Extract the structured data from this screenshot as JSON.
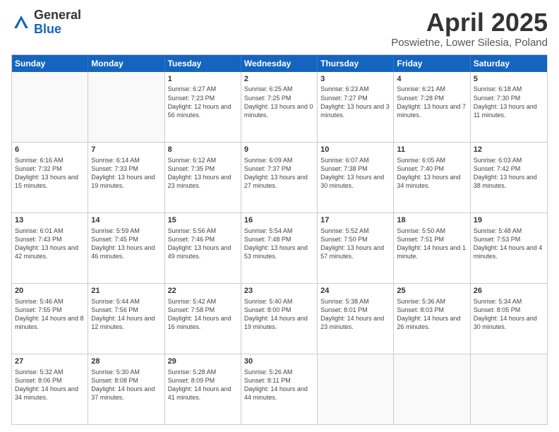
{
  "logo": {
    "general": "General",
    "blue": "Blue"
  },
  "title": {
    "month": "April 2025",
    "location": "Poswietne, Lower Silesia, Poland"
  },
  "weekdays": [
    "Sunday",
    "Monday",
    "Tuesday",
    "Wednesday",
    "Thursday",
    "Friday",
    "Saturday"
  ],
  "weeks": [
    [
      {
        "day": "",
        "info": ""
      },
      {
        "day": "",
        "info": ""
      },
      {
        "day": "1",
        "info": "Sunrise: 6:27 AM\nSunset: 7:23 PM\nDaylight: 12 hours and 56 minutes."
      },
      {
        "day": "2",
        "info": "Sunrise: 6:25 AM\nSunset: 7:25 PM\nDaylight: 13 hours and 0 minutes."
      },
      {
        "day": "3",
        "info": "Sunrise: 6:23 AM\nSunset: 7:27 PM\nDaylight: 13 hours and 3 minutes."
      },
      {
        "day": "4",
        "info": "Sunrise: 6:21 AM\nSunset: 7:28 PM\nDaylight: 13 hours and 7 minutes."
      },
      {
        "day": "5",
        "info": "Sunrise: 6:18 AM\nSunset: 7:30 PM\nDaylight: 13 hours and 11 minutes."
      }
    ],
    [
      {
        "day": "6",
        "info": "Sunrise: 6:16 AM\nSunset: 7:32 PM\nDaylight: 13 hours and 15 minutes."
      },
      {
        "day": "7",
        "info": "Sunrise: 6:14 AM\nSunset: 7:33 PM\nDaylight: 13 hours and 19 minutes."
      },
      {
        "day": "8",
        "info": "Sunrise: 6:12 AM\nSunset: 7:35 PM\nDaylight: 13 hours and 23 minutes."
      },
      {
        "day": "9",
        "info": "Sunrise: 6:09 AM\nSunset: 7:37 PM\nDaylight: 13 hours and 27 minutes."
      },
      {
        "day": "10",
        "info": "Sunrise: 6:07 AM\nSunset: 7:38 PM\nDaylight: 13 hours and 30 minutes."
      },
      {
        "day": "11",
        "info": "Sunrise: 6:05 AM\nSunset: 7:40 PM\nDaylight: 13 hours and 34 minutes."
      },
      {
        "day": "12",
        "info": "Sunrise: 6:03 AM\nSunset: 7:42 PM\nDaylight: 13 hours and 38 minutes."
      }
    ],
    [
      {
        "day": "13",
        "info": "Sunrise: 6:01 AM\nSunset: 7:43 PM\nDaylight: 13 hours and 42 minutes."
      },
      {
        "day": "14",
        "info": "Sunrise: 5:59 AM\nSunset: 7:45 PM\nDaylight: 13 hours and 46 minutes."
      },
      {
        "day": "15",
        "info": "Sunrise: 5:56 AM\nSunset: 7:46 PM\nDaylight: 13 hours and 49 minutes."
      },
      {
        "day": "16",
        "info": "Sunrise: 5:54 AM\nSunset: 7:48 PM\nDaylight: 13 hours and 53 minutes."
      },
      {
        "day": "17",
        "info": "Sunrise: 5:52 AM\nSunset: 7:50 PM\nDaylight: 13 hours and 57 minutes."
      },
      {
        "day": "18",
        "info": "Sunrise: 5:50 AM\nSunset: 7:51 PM\nDaylight: 14 hours and 1 minute."
      },
      {
        "day": "19",
        "info": "Sunrise: 5:48 AM\nSunset: 7:53 PM\nDaylight: 14 hours and 4 minutes."
      }
    ],
    [
      {
        "day": "20",
        "info": "Sunrise: 5:46 AM\nSunset: 7:55 PM\nDaylight: 14 hours and 8 minutes."
      },
      {
        "day": "21",
        "info": "Sunrise: 5:44 AM\nSunset: 7:56 PM\nDaylight: 14 hours and 12 minutes."
      },
      {
        "day": "22",
        "info": "Sunrise: 5:42 AM\nSunset: 7:58 PM\nDaylight: 14 hours and 16 minutes."
      },
      {
        "day": "23",
        "info": "Sunrise: 5:40 AM\nSunset: 8:00 PM\nDaylight: 14 hours and 19 minutes."
      },
      {
        "day": "24",
        "info": "Sunrise: 5:38 AM\nSunset: 8:01 PM\nDaylight: 14 hours and 23 minutes."
      },
      {
        "day": "25",
        "info": "Sunrise: 5:36 AM\nSunset: 8:03 PM\nDaylight: 14 hours and 26 minutes."
      },
      {
        "day": "26",
        "info": "Sunrise: 5:34 AM\nSunset: 8:05 PM\nDaylight: 14 hours and 30 minutes."
      }
    ],
    [
      {
        "day": "27",
        "info": "Sunrise: 5:32 AM\nSunset: 8:06 PM\nDaylight: 14 hours and 34 minutes."
      },
      {
        "day": "28",
        "info": "Sunrise: 5:30 AM\nSunset: 8:08 PM\nDaylight: 14 hours and 37 minutes."
      },
      {
        "day": "29",
        "info": "Sunrise: 5:28 AM\nSunset: 8:09 PM\nDaylight: 14 hours and 41 minutes."
      },
      {
        "day": "30",
        "info": "Sunrise: 5:26 AM\nSunset: 8:11 PM\nDaylight: 14 hours and 44 minutes."
      },
      {
        "day": "",
        "info": ""
      },
      {
        "day": "",
        "info": ""
      },
      {
        "day": "",
        "info": ""
      }
    ]
  ]
}
